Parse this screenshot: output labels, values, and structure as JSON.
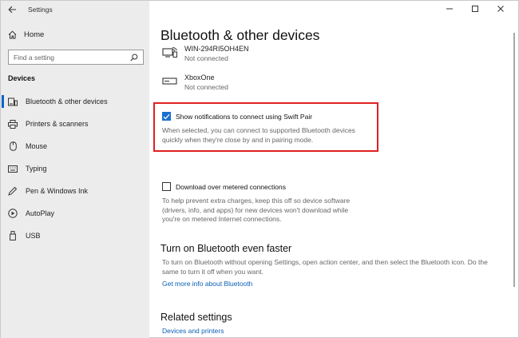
{
  "window": {
    "title": "Settings"
  },
  "sidebar": {
    "home_label": "Home",
    "search_placeholder": "Find a setting",
    "section_label": "Devices",
    "items": [
      {
        "label": "Bluetooth & other devices",
        "icon": "bluetooth-devices-icon",
        "selected": true
      },
      {
        "label": "Printers & scanners",
        "icon": "printer-icon",
        "selected": false
      },
      {
        "label": "Mouse",
        "icon": "mouse-icon",
        "selected": false
      },
      {
        "label": "Typing",
        "icon": "keyboard-icon",
        "selected": false
      },
      {
        "label": "Pen & Windows Ink",
        "icon": "pen-icon",
        "selected": false
      },
      {
        "label": "AutoPlay",
        "icon": "autoplay-icon",
        "selected": false
      },
      {
        "label": "USB",
        "icon": "usb-icon",
        "selected": false
      }
    ]
  },
  "main": {
    "title": "Bluetooth & other devices",
    "devices": [
      {
        "name": "WIN-294RI5OH4EN",
        "status": "Not connected",
        "icon": "network-pc-icon"
      },
      {
        "name": "XboxOne",
        "status": "Not connected",
        "icon": "console-icon"
      }
    ],
    "swift_pair": {
      "label": "Show notifications to connect using Swift Pair",
      "checked": true,
      "desc_line1": "When selected, you can connect to supported Bluetooth devices",
      "desc_line2": "quickly when they're close by and in pairing mode."
    },
    "metered": {
      "label": "Download over metered connections",
      "checked": false,
      "desc_line1": "To help prevent extra charges, keep this off so device software",
      "desc_line2": "(drivers, info, and apps) for new devices won't download while",
      "desc_line3": "you're on metered Internet connections."
    },
    "faster": {
      "heading": "Turn on Bluetooth even faster",
      "desc_line1": "To turn on Bluetooth without opening Settings, open action center, and then select the Bluetooth icon. Do the",
      "desc_line2": "same to turn it off when you want.",
      "link": "Get more info about Bluetooth"
    },
    "related": {
      "heading": "Related settings",
      "link": "Devices and printers"
    }
  },
  "colors": {
    "accent": "#1a6fd0",
    "highlight": "#e02020",
    "link": "#0a5fb4",
    "sidebar_bg": "#ececec"
  }
}
